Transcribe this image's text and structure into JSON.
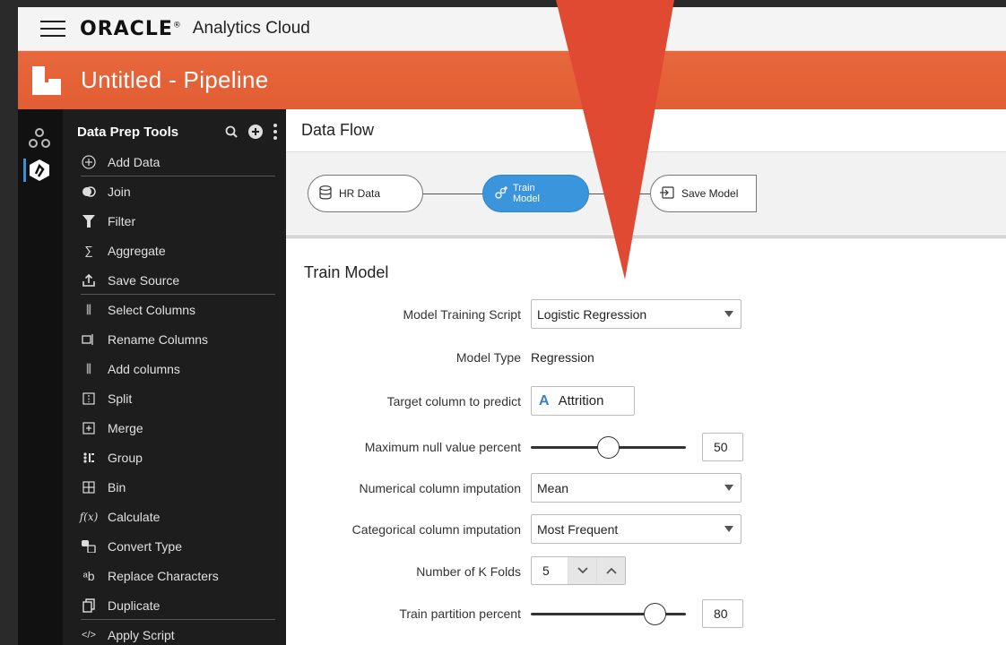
{
  "topbar": {
    "brand": "ORACLE",
    "brand_mark": "®",
    "product": "Analytics Cloud"
  },
  "titlebar": {
    "title": "Untitled - Pipeline"
  },
  "tools": {
    "title": "Data Prep Tools",
    "items": [
      {
        "label": "Add Data",
        "icon": "plus-circle-icon"
      },
      {
        "label": "Join",
        "icon": "join-icon"
      },
      {
        "label": "Filter",
        "icon": "filter-icon"
      },
      {
        "label": "Aggregate",
        "icon": "sigma-icon"
      },
      {
        "label": "Save Source",
        "icon": "upload-icon"
      },
      {
        "label": "Select Columns",
        "icon": "select-columns-icon"
      },
      {
        "label": "Rename Columns",
        "icon": "rename-columns-icon"
      },
      {
        "label": "Add columns",
        "icon": "add-columns-icon"
      },
      {
        "label": "Split",
        "icon": "split-icon"
      },
      {
        "label": "Merge",
        "icon": "merge-icon"
      },
      {
        "label": "Group",
        "icon": "group-icon"
      },
      {
        "label": "Bin",
        "icon": "bin-icon"
      },
      {
        "label": "Calculate",
        "icon": "function-icon"
      },
      {
        "label": "Convert Type",
        "icon": "convert-type-icon"
      },
      {
        "label": "Replace Characters",
        "icon": "replace-characters-icon"
      },
      {
        "label": "Duplicate",
        "icon": "duplicate-icon"
      },
      {
        "label": "Apply Script",
        "icon": "code-icon"
      }
    ]
  },
  "flow": {
    "header": "Data Flow",
    "nodes": [
      {
        "label": "HR Data"
      },
      {
        "label_line1": "Train",
        "label_line2": "Model"
      },
      {
        "label": "Save Model"
      }
    ]
  },
  "form": {
    "title": "Train Model",
    "model_training_script": {
      "label": "Model Training Script",
      "value": "Logistic Regression"
    },
    "model_type": {
      "label": "Model Type",
      "value": "Regression"
    },
    "target_column": {
      "label": "Target column to predict",
      "value": "Attrition",
      "type_glyph": "A"
    },
    "max_null": {
      "label": "Maximum null value percent",
      "value": "50",
      "level": 0.5
    },
    "numerical_imputation": {
      "label": "Numerical column imputation",
      "value": "Mean"
    },
    "categorical_imputation": {
      "label": "Categorical column imputation",
      "value": "Most Frequent"
    },
    "k_folds": {
      "label": "Number of K Folds",
      "value": "5"
    },
    "train_partition": {
      "label": "Train partition percent",
      "value": "80",
      "level": 0.8
    }
  },
  "colors": {
    "accent_orange": "#e25d33",
    "node_blue": "#3b95dc",
    "arrow_red": "#e04a32"
  }
}
